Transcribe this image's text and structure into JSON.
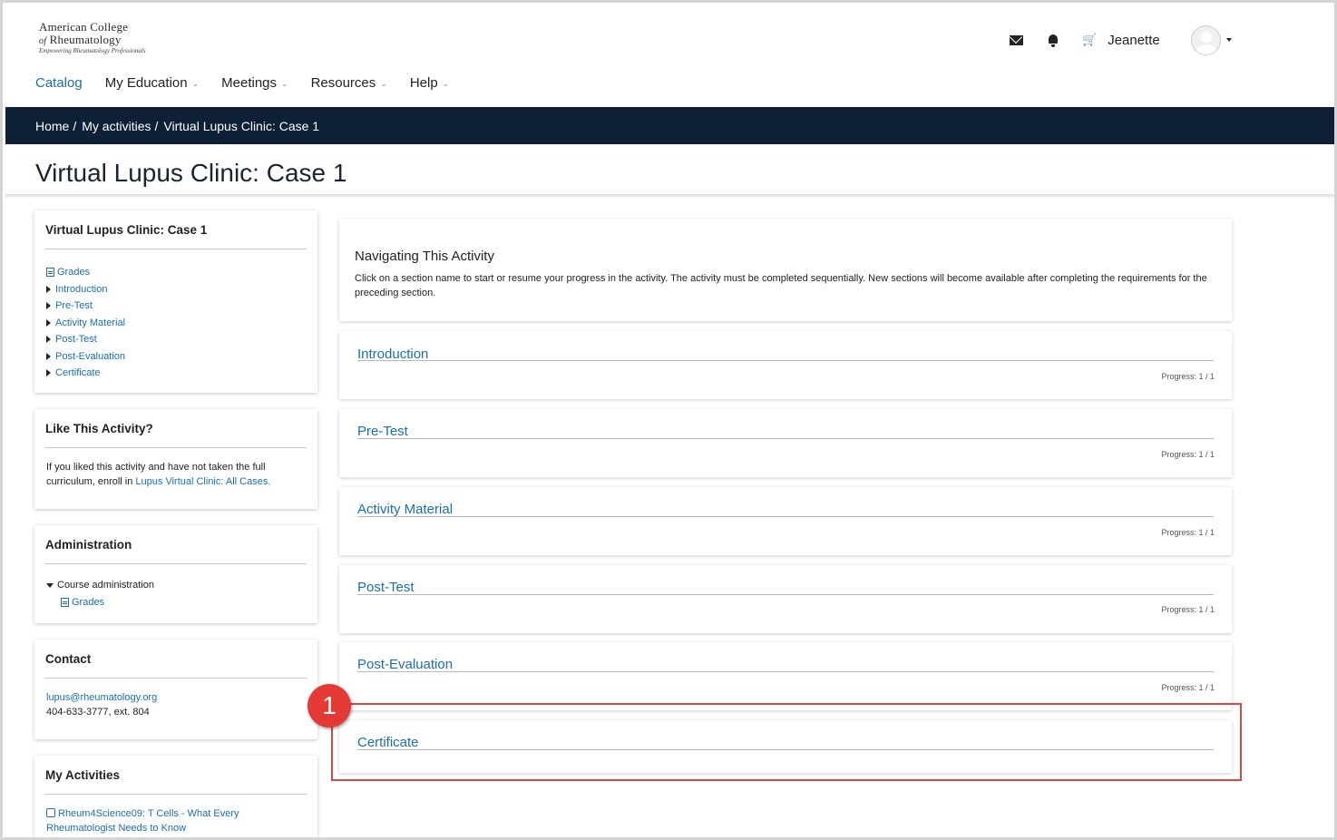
{
  "logo": {
    "line1": "American College",
    "line2_of": "of",
    "line2": "Rheumatology",
    "tagline": "Empowering Rheumatology Professionals"
  },
  "user": {
    "name": "Jeanette"
  },
  "nav": {
    "items": [
      {
        "label": "Catalog",
        "active": true,
        "dropdown": false
      },
      {
        "label": "My Education",
        "dropdown": true
      },
      {
        "label": "Meetings",
        "dropdown": true
      },
      {
        "label": "Resources",
        "dropdown": true
      },
      {
        "label": "Help",
        "dropdown": true
      }
    ]
  },
  "breadcrumb": {
    "items": [
      "Home",
      "My activities",
      "Virtual Lupus Clinic: Case 1"
    ],
    "separator": "/"
  },
  "page_title": "Virtual Lupus Clinic: Case 1",
  "sidebar": {
    "activity_block": {
      "title": "Virtual Lupus Clinic: Case 1",
      "grades": "Grades",
      "sections": [
        "Introduction",
        "Pre-Test",
        "Activity Material",
        "Post-Test",
        "Post-Evaluation",
        "Certificate"
      ]
    },
    "like_block": {
      "title": "Like This Activity?",
      "text": "If you liked this activity and have not taken the full curriculum, enroll in ",
      "link": "Lupus Virtual Clinic: All Cases",
      "text_end": "."
    },
    "admin_block": {
      "title": "Administration",
      "course_admin": "Course administration",
      "grades": "Grades"
    },
    "contact_block": {
      "title": "Contact",
      "email": "lupus@rheumatology.org",
      "phone": "404-633-3777, ext. 804"
    },
    "activities_block": {
      "title": "My Activities",
      "item": "Rheum4Science09: T Cells - What Every Rheumatologist Needs to Know"
    }
  },
  "main": {
    "nav_title": "Navigating This Activity",
    "nav_desc": "Click on a section name to start or resume your progress in the activity. The activity must be completed sequentially. New sections will become available after completing the requirements for the preceding section.",
    "sections": [
      {
        "name": "Introduction",
        "progress": "Progress: 1 / 1"
      },
      {
        "name": "Pre-Test",
        "progress": "Progress: 1 / 1"
      },
      {
        "name": "Activity Material",
        "progress": "Progress: 1 / 1"
      },
      {
        "name": "Post-Test",
        "progress": "Progress: 1 / 1"
      },
      {
        "name": "Post-Evaluation",
        "progress": "Progress: 1 / 1"
      },
      {
        "name": "Certificate",
        "progress": ""
      }
    ]
  },
  "callout": {
    "number": "1"
  },
  "colors": {
    "accent": "#1a6fb0",
    "breadcrumb_bg": "#0e2036",
    "callout": "#e53935"
  }
}
